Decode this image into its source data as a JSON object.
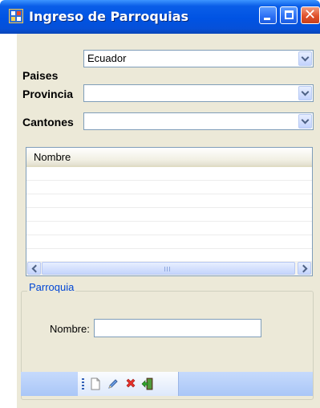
{
  "window": {
    "title": "Ingreso de Parroquias",
    "icon": "form-app-icon",
    "controls": [
      "minimize-icon",
      "maximize-icon",
      "close-icon"
    ]
  },
  "filters": {
    "paises": {
      "label": "Paises",
      "value": "Ecuador"
    },
    "provincia": {
      "label": "Provincia",
      "value": ""
    },
    "cantones": {
      "label": "Cantones",
      "value": ""
    }
  },
  "grid": {
    "columns": [
      "Nombre"
    ],
    "rows": []
  },
  "parroquia_group": {
    "legend": "Parroquia",
    "nombre_label": "Nombre:",
    "nombre_value": ""
  },
  "toolbar": {
    "items": [
      "new-document-icon",
      "edit-pencil-icon",
      "delete-x-icon",
      "exit-door-icon"
    ]
  },
  "colors": {
    "titlebar": "#0053e3",
    "client_bg": "#ece9d8",
    "group_legend": "#0046d5",
    "toolstrip": "#b9d1fa"
  }
}
